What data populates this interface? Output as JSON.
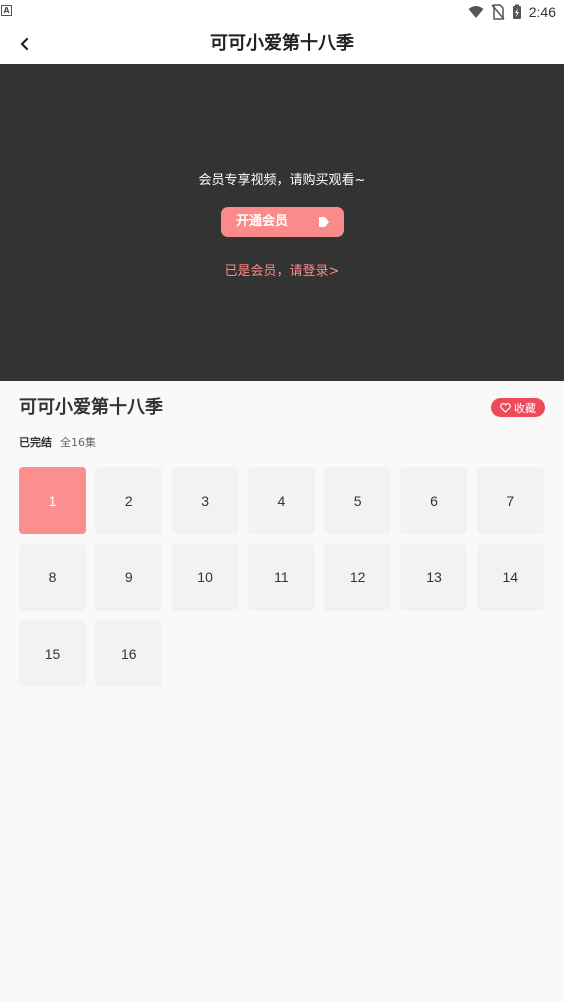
{
  "status_bar": {
    "left_indicator": "A",
    "time": "2:46"
  },
  "header": {
    "title": "可可小爱第十八季"
  },
  "player": {
    "message": "会员专享视频，请购买观看~",
    "open_vip_label": "开通会员",
    "login_link": "已是会员，请登录>"
  },
  "info": {
    "title": "可可小爱第十八季",
    "favorite_label": "收藏",
    "status": "已完结",
    "total": "全16集"
  },
  "episodes": {
    "selected": "1",
    "items": [
      "1",
      "2",
      "3",
      "4",
      "5",
      "6",
      "7",
      "8",
      "9",
      "10",
      "11",
      "12",
      "13",
      "14",
      "15",
      "16"
    ]
  },
  "colors": {
    "accent": "#fb8a8a",
    "favorite": "#f04a5a",
    "player_bg": "#333333"
  }
}
